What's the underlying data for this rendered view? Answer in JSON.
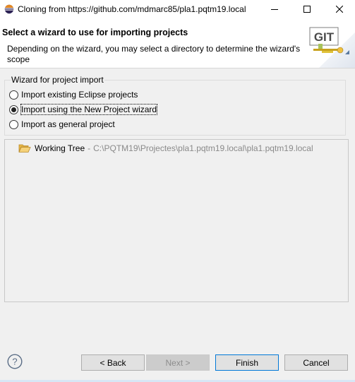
{
  "window": {
    "title": "Cloning from https://github.com/mdmarc85/pla1.pqtm19.local"
  },
  "header": {
    "title": "Select a wizard to use for importing projects",
    "description": "Depending on the wizard, you may select a directory to determine the wizard's scope",
    "banner_text": "GIT"
  },
  "wizard_group": {
    "legend": "Wizard for project import",
    "options": [
      {
        "label": "Import existing Eclipse projects",
        "checked": false
      },
      {
        "label": "Import using the New Project wizard",
        "checked": true
      },
      {
        "label": "Import as general project",
        "checked": false
      }
    ]
  },
  "tree": {
    "item_name": "Working Tree",
    "separator": "-",
    "item_path": "C:\\PQTM19\\Projectes\\pla1.pqtm19.local\\pla1.pqtm19.local"
  },
  "buttons": {
    "back": "< Back",
    "next": "Next >",
    "finish": "Finish",
    "cancel": "Cancel"
  },
  "icons": {
    "window": "eclipse-icon",
    "minimize": "minimize-icon",
    "maximize": "maximize-icon",
    "close": "close-icon",
    "banner": "git-import-icon",
    "folder": "folder-open-icon",
    "help": "help-icon"
  },
  "colors": {
    "accent": "#0078d7",
    "dialog_bg": "#f0f0f0",
    "header_bg": "#ffffff",
    "muted_text": "#8a8a8a"
  }
}
